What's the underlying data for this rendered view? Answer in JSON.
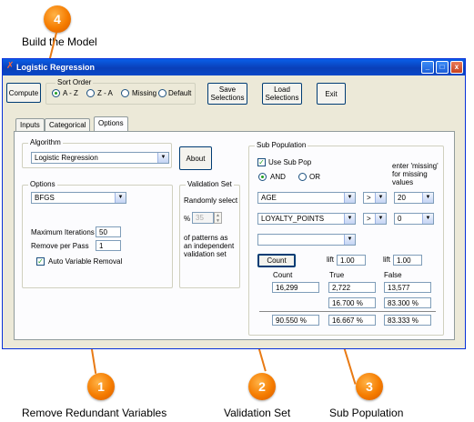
{
  "callouts": {
    "build": {
      "number": "4",
      "label": "Build the Model"
    },
    "remove": {
      "number": "1",
      "label": "Remove Redundant Variables"
    },
    "validation": {
      "number": "2",
      "label": "Validation Set"
    },
    "subpop": {
      "number": "3",
      "label": "Sub Population"
    }
  },
  "window": {
    "title": "Logistic Regression",
    "controls": {
      "minimize": "_",
      "maximize": "□",
      "close": "x"
    }
  },
  "toolbar": {
    "compute": "Compute",
    "sort_order_title": "Sort Order",
    "sort_options": [
      "A - Z",
      "Z - A",
      "Missing",
      "Default"
    ],
    "sort_selected": "A - Z",
    "save": "Save Selections",
    "load": "Load Selections",
    "exit": "Exit"
  },
  "tabs": [
    {
      "label": "Inputs",
      "active": false
    },
    {
      "label": "Categorical",
      "active": false
    },
    {
      "label": "Options",
      "active": true
    }
  ],
  "algorithm": {
    "title": "Algorithm",
    "value": "Logistic Regression",
    "about": "About"
  },
  "options": {
    "title": "Options",
    "method": "BFGS",
    "max_iter_label": "Maximum Iterations",
    "max_iter_value": "50",
    "remove_label": "Remove per Pass",
    "remove_value": "1",
    "auto_label": "Auto Variable Removal",
    "auto_checked": true
  },
  "validation": {
    "title": "Validation Set",
    "randomly": "Randomly select",
    "pct_symbol": "%",
    "pct_value": "35",
    "desc_line1": "of patterns as",
    "desc_line2": "an independent",
    "desc_line3": "validation set"
  },
  "subpop": {
    "title": "Sub Population",
    "use_label": "Use Sub Pop",
    "use_checked": true,
    "and_label": "AND",
    "or_label": "OR",
    "logic_selected": "AND",
    "missing_hint_1": "enter 'missing'",
    "missing_hint_2": "for missing",
    "missing_hint_3": "values",
    "rows": [
      {
        "field": "AGE",
        "op": ">",
        "value": "20"
      },
      {
        "field": "LOYALTY_POINTS",
        "op": ">",
        "value": "0"
      },
      {
        "field": "",
        "op": "",
        "value": ""
      }
    ],
    "count_button": "Count",
    "lift_label": "lift",
    "lift_true": "1.00",
    "lift_false": "1.00",
    "col_count": "Count",
    "col_true": "True",
    "col_false": "False",
    "count_value": "16,299",
    "true_value": "2,722",
    "false_value": "13,577",
    "true_pct_row": "16.700 %",
    "false_pct_row": "83.300 %",
    "total_pct": "90.550 %",
    "true_pct_total": "16.667 %",
    "false_pct_total": "83.333 %"
  },
  "colors": {
    "callout": "#f57c00",
    "titlebar": "#0a3fb8",
    "window_bg": "#ece9d8"
  }
}
